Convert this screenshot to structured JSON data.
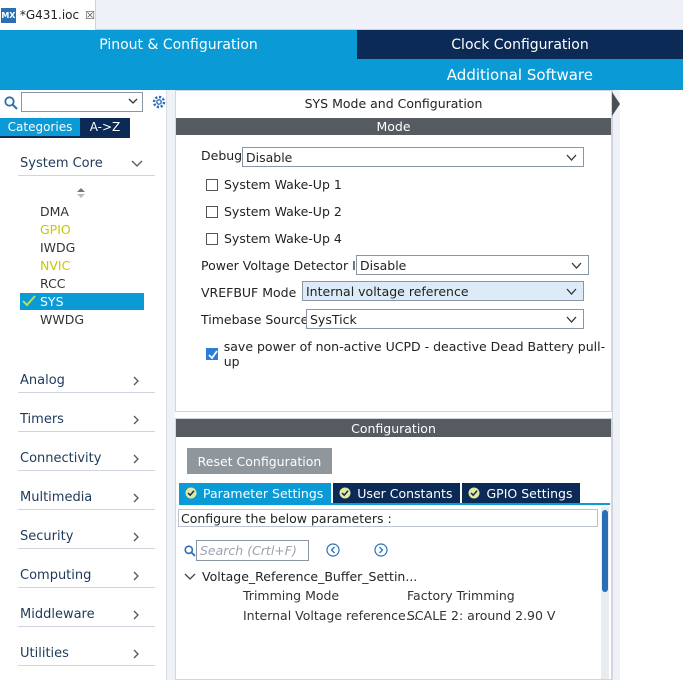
{
  "tab": {
    "icon_text": "MX",
    "file_name": "*G431.ioc",
    "close_glyph": "☒"
  },
  "nav": {
    "pinout": "Pinout & Configuration",
    "clock": "Clock Configuration",
    "additional": "Additional Software"
  },
  "sidebar": {
    "search_value": "",
    "tabs": {
      "categories": "Categories",
      "az": "A->Z"
    },
    "system_core": "System Core",
    "items": [
      {
        "label": "DMA",
        "state": "normal"
      },
      {
        "label": "GPIO",
        "state": "warning"
      },
      {
        "label": "IWDG",
        "state": "normal"
      },
      {
        "label": "NVIC",
        "state": "warning"
      },
      {
        "label": "RCC",
        "state": "normal"
      },
      {
        "label": "SYS",
        "state": "selected"
      },
      {
        "label": "WWDG",
        "state": "normal"
      }
    ],
    "sections": [
      "Analog",
      "Timers",
      "Connectivity",
      "Multimedia",
      "Security",
      "Computing",
      "Middleware",
      "Utilities"
    ]
  },
  "mode": {
    "title": "SYS Mode and Configuration",
    "header": "Mode",
    "debug_label": "Debug",
    "debug_value": "Disable",
    "wakeups": [
      {
        "label": "System Wake-Up 1",
        "checked": false
      },
      {
        "label": "System Wake-Up 2",
        "checked": false
      },
      {
        "label": "System Wake-Up 4",
        "checked": false
      }
    ],
    "pvd_label": "Power Voltage Detector In",
    "pvd_value": "Disable",
    "vrefbuf_label": "VREFBUF Mode",
    "vrefbuf_value": "Internal voltage reference",
    "timebase_label": "Timebase Source",
    "timebase_value": "SysTick",
    "ucpd_label": "save power of non-active UCPD - deactive Dead Battery pull-up",
    "ucpd_checked": true
  },
  "config": {
    "header": "Configuration",
    "reset_button": "Reset Configuration",
    "tabs": [
      "Parameter Settings",
      "User Constants",
      "GPIO Settings"
    ],
    "description": "Configure the below parameters :",
    "search_placeholder": "Search (Crtl+F)",
    "group": "Voltage_Reference_Buffer_Settin...",
    "params": [
      {
        "name": "Trimming Mode",
        "value": "Factory Trimming"
      },
      {
        "name": "Internal Voltage reference...",
        "value": "SCALE 2: around 2.90 V"
      }
    ]
  },
  "colors": {
    "accent": "#0a9ad6",
    "dark": "#0b2a55",
    "header_gray": "#555b61",
    "warning": "#c8c800"
  }
}
